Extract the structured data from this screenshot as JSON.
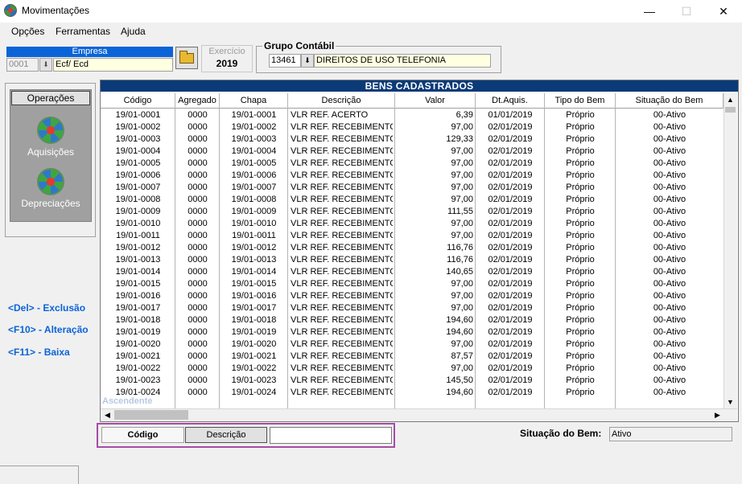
{
  "window": {
    "title": "Movimentações"
  },
  "menu": [
    "Opções",
    "Ferramentas",
    "Ajuda"
  ],
  "empresa": {
    "label": "Empresa",
    "code": "0001",
    "name": "Ecf/ Ecd"
  },
  "exercicio": {
    "label": "Exercício",
    "value": "2019"
  },
  "grupo": {
    "label": "Grupo  Contábil",
    "code": "13461",
    "name": "DIREITOS DE USO TELEFONIA"
  },
  "operacoes": {
    "title": "Operações",
    "items": [
      "Aquisições",
      "Depreciações"
    ]
  },
  "shortcuts": [
    "<Del> - Exclusão",
    "<F10> - Alteração",
    "<F11> - Baixa"
  ],
  "grid": {
    "title": "BENS CADASTRADOS",
    "columns": [
      "Código",
      "Agregado",
      "Chapa",
      "Descrição",
      "Valor",
      "Dt.Aquis.",
      "Tipo do Bem",
      "Situação do Bem"
    ],
    "rows": [
      [
        "19/01-0001",
        "0000",
        "19/01-0001",
        "VLR REF. ACERTO",
        "6,39",
        "01/01/2019",
        "Próprio",
        "00-Ativo"
      ],
      [
        "19/01-0002",
        "0000",
        "19/01-0002",
        "VLR REF. RECEBIMENTO",
        "97,00",
        "02/01/2019",
        "Próprio",
        "00-Ativo"
      ],
      [
        "19/01-0003",
        "0000",
        "19/01-0003",
        "VLR REF. RECEBIMENTO",
        "129,33",
        "02/01/2019",
        "Próprio",
        "00-Ativo"
      ],
      [
        "19/01-0004",
        "0000",
        "19/01-0004",
        "VLR REF. RECEBIMENTO",
        "97,00",
        "02/01/2019",
        "Próprio",
        "00-Ativo"
      ],
      [
        "19/01-0005",
        "0000",
        "19/01-0005",
        "VLR REF. RECEBIMENTO",
        "97,00",
        "02/01/2019",
        "Próprio",
        "00-Ativo"
      ],
      [
        "19/01-0006",
        "0000",
        "19/01-0006",
        "VLR REF. RECEBIMENTO",
        "97,00",
        "02/01/2019",
        "Próprio",
        "00-Ativo"
      ],
      [
        "19/01-0007",
        "0000",
        "19/01-0007",
        "VLR REF. RECEBIMENTO",
        "97,00",
        "02/01/2019",
        "Próprio",
        "00-Ativo"
      ],
      [
        "19/01-0008",
        "0000",
        "19/01-0008",
        "VLR REF. RECEBIMENTO",
        "97,00",
        "02/01/2019",
        "Próprio",
        "00-Ativo"
      ],
      [
        "19/01-0009",
        "0000",
        "19/01-0009",
        "VLR REF. RECEBIMENTO",
        "111,55",
        "02/01/2019",
        "Próprio",
        "00-Ativo"
      ],
      [
        "19/01-0010",
        "0000",
        "19/01-0010",
        "VLR REF. RECEBIMENTO",
        "97,00",
        "02/01/2019",
        "Próprio",
        "00-Ativo"
      ],
      [
        "19/01-0011",
        "0000",
        "19/01-0011",
        "VLR REF. RECEBIMENTO",
        "97,00",
        "02/01/2019",
        "Próprio",
        "00-Ativo"
      ],
      [
        "19/01-0012",
        "0000",
        "19/01-0012",
        "VLR REF. RECEBIMENTO",
        "116,76",
        "02/01/2019",
        "Próprio",
        "00-Ativo"
      ],
      [
        "19/01-0013",
        "0000",
        "19/01-0013",
        "VLR REF. RECEBIMENTO",
        "116,76",
        "02/01/2019",
        "Próprio",
        "00-Ativo"
      ],
      [
        "19/01-0014",
        "0000",
        "19/01-0014",
        "VLR REF. RECEBIMENTO",
        "140,65",
        "02/01/2019",
        "Próprio",
        "00-Ativo"
      ],
      [
        "19/01-0015",
        "0000",
        "19/01-0015",
        "VLR REF. RECEBIMENTO",
        "97,00",
        "02/01/2019",
        "Próprio",
        "00-Ativo"
      ],
      [
        "19/01-0016",
        "0000",
        "19/01-0016",
        "VLR REF. RECEBIMENTO",
        "97,00",
        "02/01/2019",
        "Próprio",
        "00-Ativo"
      ],
      [
        "19/01-0017",
        "0000",
        "19/01-0017",
        "VLR REF. RECEBIMENTO",
        "97,00",
        "02/01/2019",
        "Próprio",
        "00-Ativo"
      ],
      [
        "19/01-0018",
        "0000",
        "19/01-0018",
        "VLR REF. RECEBIMENTO",
        "194,60",
        "02/01/2019",
        "Próprio",
        "00-Ativo"
      ],
      [
        "19/01-0019",
        "0000",
        "19/01-0019",
        "VLR REF. RECEBIMENTO",
        "194,60",
        "02/01/2019",
        "Próprio",
        "00-Ativo"
      ],
      [
        "19/01-0020",
        "0000",
        "19/01-0020",
        "VLR REF. RECEBIMENTO",
        "97,00",
        "02/01/2019",
        "Próprio",
        "00-Ativo"
      ],
      [
        "19/01-0021",
        "0000",
        "19/01-0021",
        "VLR REF. RECEBIMENTO",
        "87,57",
        "02/01/2019",
        "Próprio",
        "00-Ativo"
      ],
      [
        "19/01-0022",
        "0000",
        "19/01-0022",
        "VLR REF. RECEBIMENTO",
        "97,00",
        "02/01/2019",
        "Próprio",
        "00-Ativo"
      ],
      [
        "19/01-0023",
        "0000",
        "19/01-0023",
        "VLR REF. RECEBIMENTO",
        "145,50",
        "02/01/2019",
        "Próprio",
        "00-Ativo"
      ],
      [
        "19/01-0024",
        "0000",
        "19/01-0024",
        "VLR REF. RECEBIMENTO",
        "194,60",
        "02/01/2019",
        "Próprio",
        "00-Ativo"
      ]
    ],
    "sort_label": "Ascendente"
  },
  "search": {
    "buttons": [
      "Código",
      "Descrição"
    ],
    "value": ""
  },
  "situacao": {
    "label": "Situação do Bem:",
    "value": "Ativo"
  },
  "colors": {
    "accent": "#0a64d8",
    "grid_title": "#0a3a78",
    "search_frame": "#a64ca6"
  }
}
